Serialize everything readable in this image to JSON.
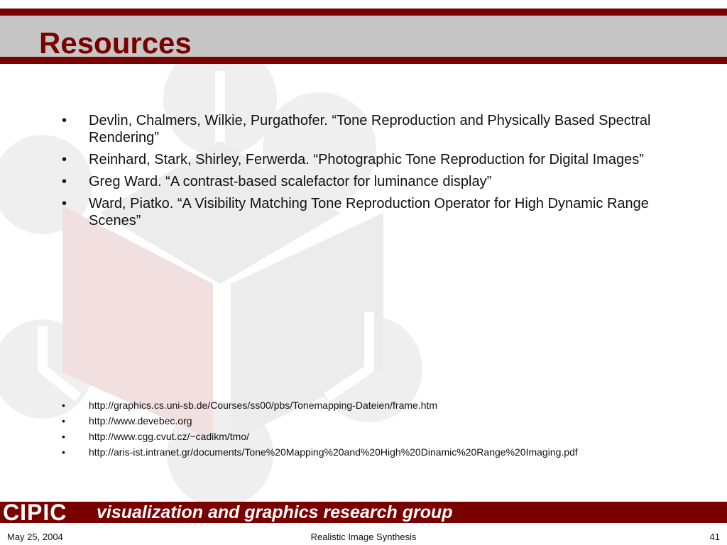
{
  "slide": {
    "title": "Resources"
  },
  "references": [
    {
      "bullet": "•",
      "text": "Devlin, Chalmers, Wilkie, Purgathofer. “Tone Reproduction and Physically Based Spectral Rendering”"
    },
    {
      "bullet": "•",
      "text": "Reinhard, Stark, Shirley, Ferwerda. “Photographic Tone Reproduction for Digital Images”"
    },
    {
      "bullet": "•",
      "text": "Greg Ward.  “A contrast-based scalefactor for luminance display”"
    },
    {
      "bullet": "•",
      "text": "Ward, Piatko.  “A Visibility Matching Tone Reproduction Operator for High Dynamic Range Scenes”"
    }
  ],
  "links": [
    {
      "bullet": "•",
      "text": "http://graphics.cs.uni-sb.de/Courses/ss00/pbs/Tonemapping-Dateien/frame.htm"
    },
    {
      "bullet": "•",
      "text": "http://www.devebec.org"
    },
    {
      "bullet": "•",
      "text": "http://www.cgg.cvut.cz/~cadikm/tmo/"
    },
    {
      "bullet": "•",
      "text": "http://aris-ist.intranet.gr/documents/Tone%20Mapping%20and%20High%20Dinamic%20Range%20Imaging.pdf"
    }
  ],
  "footer": {
    "logo": "CIPIC",
    "group": "visualization and graphics research group",
    "date": "May 25, 2004",
    "center": "Realistic Image Synthesis",
    "page": "41"
  },
  "colors": {
    "brand": "#7a0000",
    "title_band": "#c6c6c6",
    "watermark": "#eeeeee",
    "watermark_accent": "#f3e2e2"
  },
  "icons": {
    "watermark": "cube-logo-watermark"
  }
}
